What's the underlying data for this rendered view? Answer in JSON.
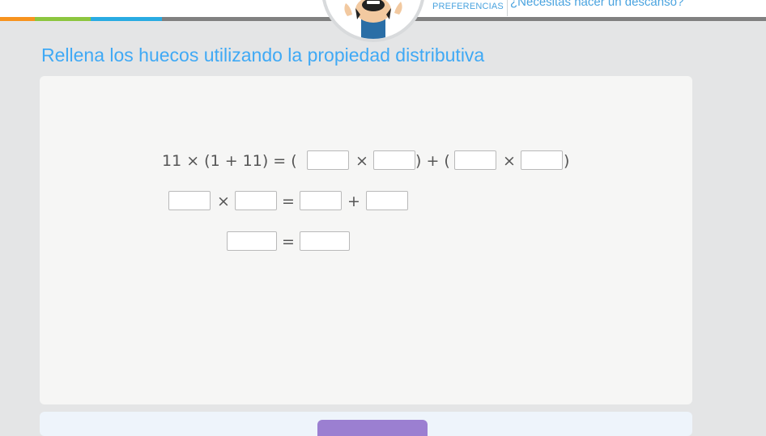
{
  "header": {
    "preferences_label": "PREFERENCIAS",
    "break_label": "¿Necesitas hacer un descanso?"
  },
  "exercise": {
    "title": "Rellena los huecos utilizando la propiedad distributiva",
    "row1": {
      "lhs": "11 × (1 + 11) = (",
      "times": "×",
      "close_plus_open": ") + (",
      "close": ")"
    },
    "row2": {
      "times": "×",
      "equals": "=",
      "plus": "+"
    },
    "row3": {
      "equals": "="
    }
  },
  "colors": {
    "accent": "#3fa9f5",
    "card": "#f6f6f5",
    "page": "#e4e5e6",
    "button": "#9b7fd1"
  }
}
